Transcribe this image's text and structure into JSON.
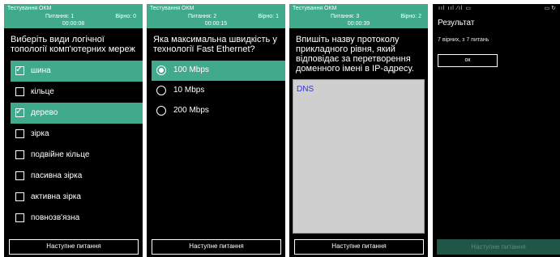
{
  "header": {
    "app_title": "Тестування ОКМ",
    "questions_label": "Питання:",
    "correct_label": "Вірно:"
  },
  "screen1": {
    "question_num": "1",
    "correct": "0",
    "timer": "00:00:08",
    "question": "Виберіть види логічної топології комп'ютерних мереж",
    "options": [
      {
        "label": "шина",
        "checked": true
      },
      {
        "label": "кільце",
        "checked": false
      },
      {
        "label": "дерево",
        "checked": true
      },
      {
        "label": "зірка",
        "checked": false
      },
      {
        "label": "подвійне кільце",
        "checked": false
      },
      {
        "label": "пасивна зірка",
        "checked": false
      },
      {
        "label": "активна зірка",
        "checked": false
      },
      {
        "label": "повнозв'язна",
        "checked": false
      }
    ],
    "next_label": "Наступне питання"
  },
  "screen2": {
    "question_num": "2",
    "correct": "1",
    "timer": "00:00:15",
    "question": "Яка максимальна швидкість у технології Fast Ethernet?",
    "options": [
      {
        "label": "100 Mbps",
        "selected": true
      },
      {
        "label": "10 Mbps",
        "selected": false
      },
      {
        "label": "200 Mbps",
        "selected": false
      }
    ],
    "next_label": "Наступне питання"
  },
  "screen3": {
    "question_num": "3",
    "correct": "2",
    "timer": "00:00:39",
    "question": "Впишіть назву протоколу прикладного рівня, який відповідає за перетворення доменного імені в IP-адресу.",
    "answer": "DNS",
    "next_label": "Наступне питання"
  },
  "screen4": {
    "status_left": "ııl ııl ⁄ıl ▭",
    "status_right": "▭ ↻",
    "title": "Результат",
    "summary": "7 вірних, з 7 питань",
    "ok_label": "ок",
    "next_label": "Наступне питання"
  },
  "colors": {
    "accent": "#41a98c",
    "answer_text": "#2f36c8",
    "answer_bg": "#cfcfcf",
    "disabled_button": "#1f5648"
  }
}
